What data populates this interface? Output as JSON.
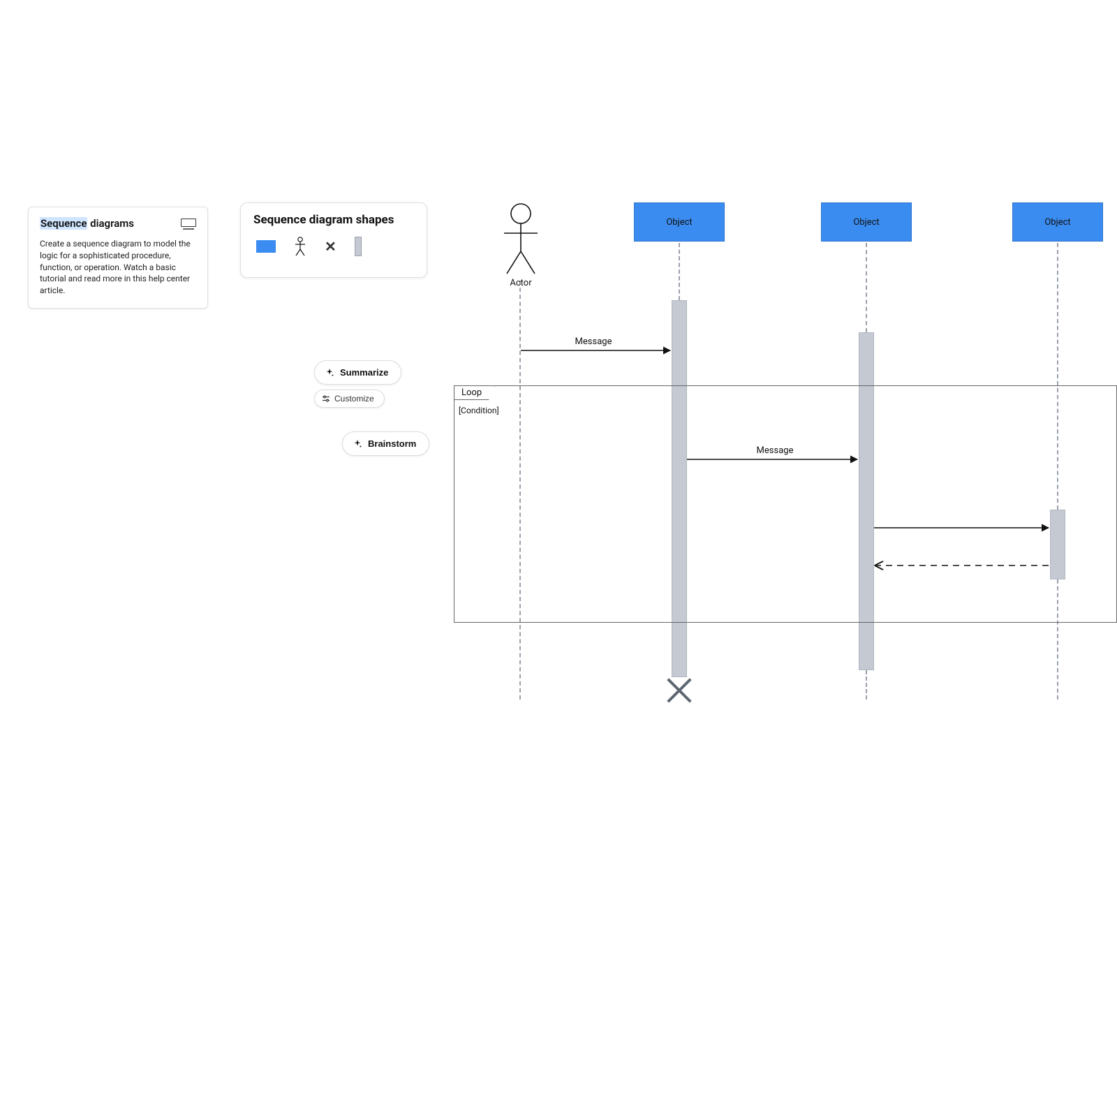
{
  "info_card": {
    "title_highlight": "Sequence",
    "title_rest": " diagrams",
    "body": "Create a sequence diagram to model the logic for a sophisticated procedure, function, or operation. Watch a basic tutorial and read more in this help center article."
  },
  "shapes_card": {
    "title": "Sequence diagram shapes"
  },
  "buttons": {
    "summarize": "Summarize",
    "customize": "Customize",
    "brainstorm": "Brainstorm"
  },
  "diagram": {
    "actor_label": "Actor",
    "object1_label": "Object",
    "object2_label": "Object",
    "object3_label": "Object",
    "loop_label": "Loop",
    "loop_condition": "[Condition]",
    "msg1": "Message",
    "msg2": "Message"
  }
}
